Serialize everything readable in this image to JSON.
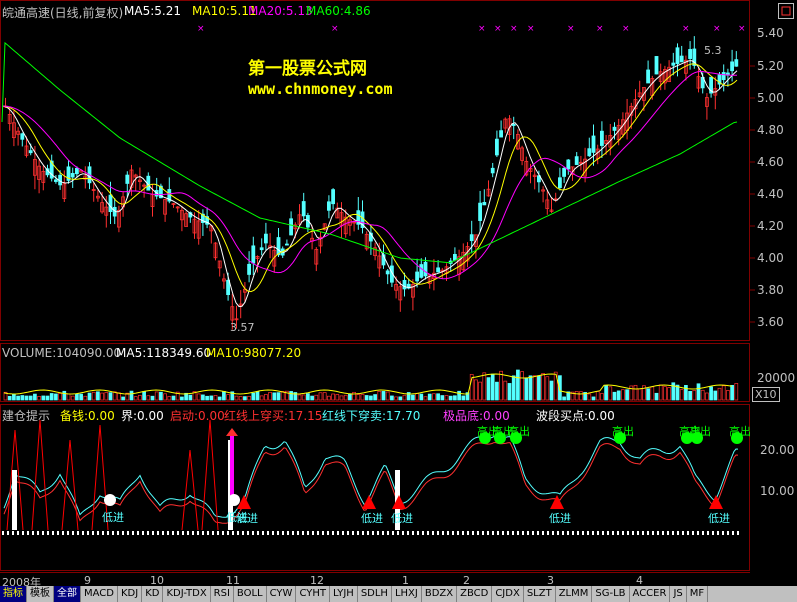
{
  "header": {
    "title": "皖通高速(日线,前复权)",
    "ma5": "MA5:5.21",
    "ma10": "MA10:5.11",
    "ma20": "MA20:5.13",
    "ma60": "MA60:4.86"
  },
  "watermark": {
    "line1": "第一股票公式网",
    "line2": "www.chnmoney.com"
  },
  "price_axis": [
    "5.20",
    "5.00",
    "4.80",
    "4.60",
    "4.40",
    "4.20",
    "4.00",
    "3.80",
    "3.60"
  ],
  "price_axis_top": "5.40",
  "low_marker": "3.57",
  "high_marker": "5.3",
  "volume": {
    "label": "VOLUME:104090.00",
    "ma5": "MA5:118349.60",
    "ma10": "MA10:98077.20",
    "axis": "20000",
    "unit": "X10"
  },
  "indicator": {
    "name": "建仓提示",
    "beiqian": "备钱:0.00",
    "jie": "界:0.00",
    "qidong": "启动:0.00",
    "hongxian_up": "红线上穿买:17.15",
    "hongxian_down": "红线下穿卖:17.70",
    "jipindi": "极品底:0.00",
    "boduan": "波段买点:0.00",
    "axis": [
      "20.00",
      "10.00"
    ],
    "gaochu": "高出",
    "dijin": "低进"
  },
  "dates": [
    "2008年",
    "9",
    "10",
    "11",
    "12",
    "1",
    "2",
    "3",
    "4"
  ],
  "tabs": [
    "指标",
    "模板",
    "全部",
    "MACD",
    "KDJ",
    "KD",
    "KDJ-TDX",
    "RSI",
    "BOLL",
    "CYW",
    "CYHT",
    "LYJH",
    "SDLH",
    "LHXJ",
    "BDZX",
    "ZBCD",
    "CJDX",
    "SLZT",
    "ZLMM",
    "SG-LB",
    "ACCER",
    "JS",
    "MF"
  ],
  "colors": {
    "up": "#ff3030",
    "down": "#54ffff",
    "ma5": "#ffffff",
    "ma10": "#ffff00",
    "ma20": "#ff00ff",
    "ma60": "#00ff00",
    "grid": "#800000"
  }
}
